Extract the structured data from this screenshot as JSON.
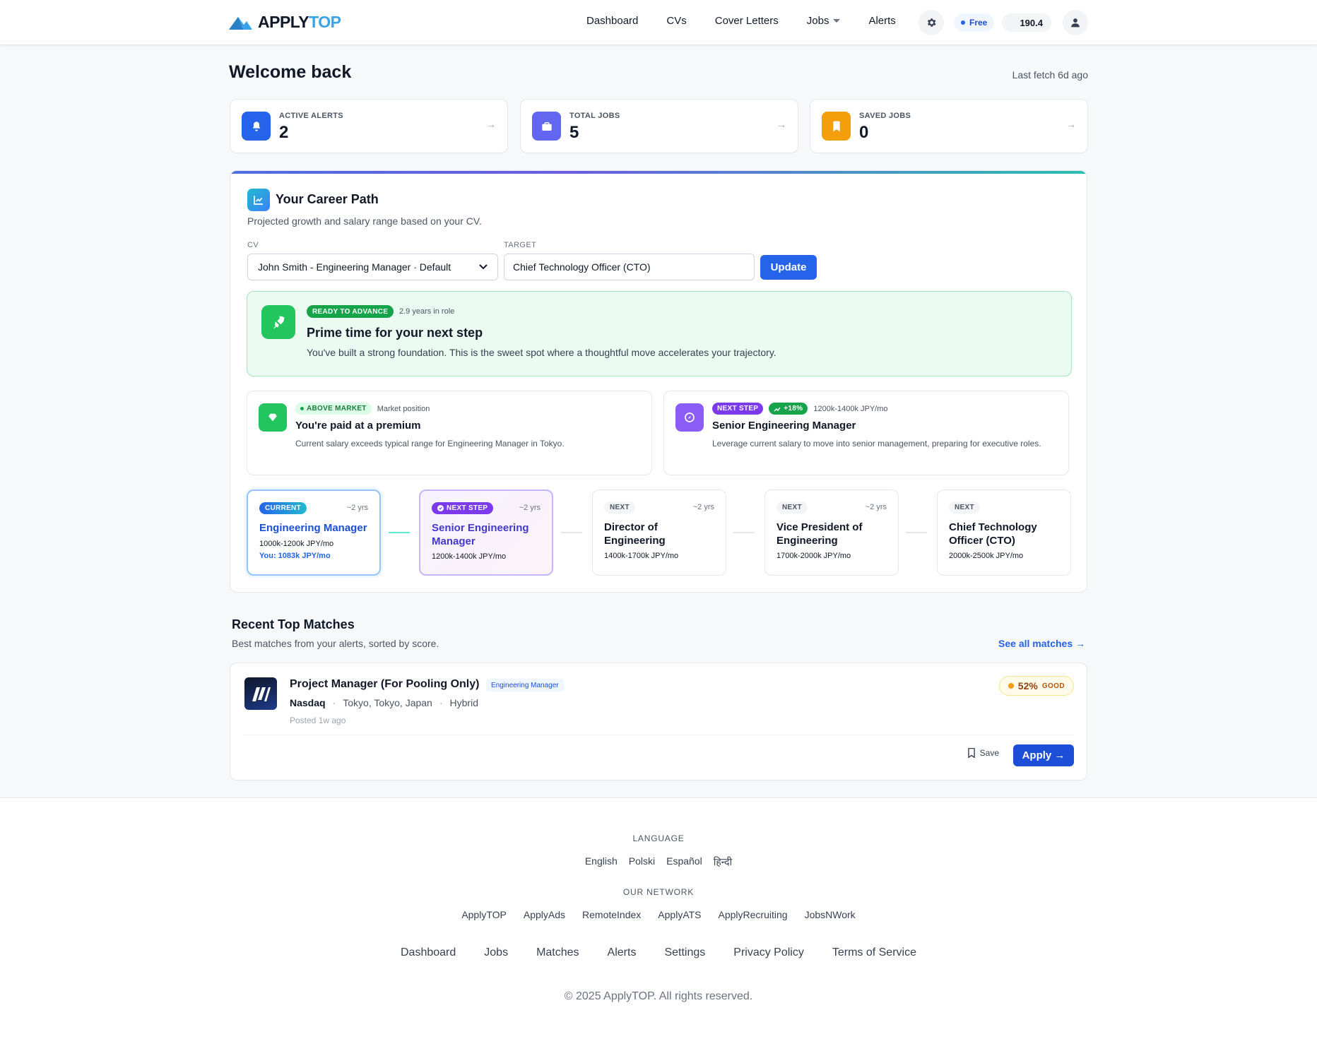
{
  "brand": {
    "part1": "APPLY",
    "part2": "TOP"
  },
  "nav": {
    "links": [
      "Dashboard",
      "CVs",
      "Cover Letters",
      "Jobs",
      "Alerts"
    ],
    "plan": "Free",
    "credits": "190.4"
  },
  "header": {
    "title": "Welcome back",
    "last_fetch": "Last fetch 6d ago"
  },
  "stats": [
    {
      "label": "ACTIVE ALERTS",
      "value": "2",
      "icon": "bell-icon",
      "color": "#2563eb"
    },
    {
      "label": "TOTAL JOBS",
      "value": "5",
      "icon": "briefcase-icon",
      "color": "#6366f1"
    },
    {
      "label": "SAVED JOBS",
      "value": "0",
      "icon": "bookmark-icon",
      "color": "#f59e0b"
    }
  ],
  "career": {
    "title": "Your Career Path",
    "subtitle": "Projected growth and salary range based on your CV.",
    "cv_label": "CV",
    "cv_value": "John Smith - Engineering Manager · Default",
    "target_label": "TARGET",
    "target_value": "Chief Technology Officer (CTO)",
    "update_label": "Update",
    "ready": {
      "badge": "READY TO ADVANCE",
      "years": "2.9 years in role",
      "title": "Prime time for your next step",
      "desc": "You've built a strong foundation. This is the sweet spot where a thoughtful move accelerates your trajectory."
    },
    "market": {
      "badge": "ABOVE MARKET",
      "meta": "Market position",
      "title": "You're paid at a premium",
      "desc": "Current salary exceeds typical range for Engineering Manager in Tokyo."
    },
    "next": {
      "badge": "NEXT STEP",
      "growth": "+18%",
      "meta": "1200k-1400k JPY/mo",
      "title": "Senior Engineering Manager",
      "desc": "Leverage current salary to move into senior management, preparing for executive roles."
    },
    "steps": [
      {
        "tag": "CURRENT",
        "years": "~2 yrs",
        "title": "Engineering Manager",
        "salary": "1000k-1200k JPY/mo",
        "you": "You: 1083k JPY/mo"
      },
      {
        "tag": "NEXT STEP",
        "years": "~2 yrs",
        "title": "Senior Engineering Manager",
        "salary": "1200k-1400k JPY/mo"
      },
      {
        "tag": "NEXT",
        "years": "~2 yrs",
        "title": "Director of Engineering",
        "salary": "1400k-1700k JPY/mo"
      },
      {
        "tag": "NEXT",
        "years": "~2 yrs",
        "title": "Vice President of Engineering",
        "salary": "1700k-2000k JPY/mo"
      },
      {
        "tag": "NEXT",
        "years": "",
        "title": "Chief Technology Officer (CTO)",
        "salary": "2000k-2500k JPY/mo"
      }
    ]
  },
  "matches": {
    "title": "Recent Top Matches",
    "subtitle": "Best matches from your alerts, sorted by score.",
    "see_all": "See all matches →",
    "items": [
      {
        "title": "Project Manager (For Pooling Only)",
        "tag": "Engineering Manager",
        "company": "Nasdaq",
        "location": "Tokyo, Tokyo, Japan",
        "mode": "Hybrid",
        "posted": "Posted 1w ago",
        "score": "52%",
        "level": "GOOD",
        "save": "Save",
        "apply": "Apply →"
      }
    ]
  },
  "footer": {
    "language_label": "LANGUAGE",
    "languages": [
      "English",
      "Polski",
      "Español",
      "हिन्दी"
    ],
    "network_label": "OUR NETWORK",
    "network": [
      "ApplyTOP",
      "ApplyAds",
      "RemoteIndex",
      "ApplyATS",
      "ApplyRecruiting",
      "JobsNWork"
    ],
    "links": [
      "Dashboard",
      "Jobs",
      "Matches",
      "Alerts",
      "Settings",
      "Privacy Policy",
      "Terms of Service"
    ],
    "copyright": "© 2025 ApplyTOP. All rights reserved."
  }
}
